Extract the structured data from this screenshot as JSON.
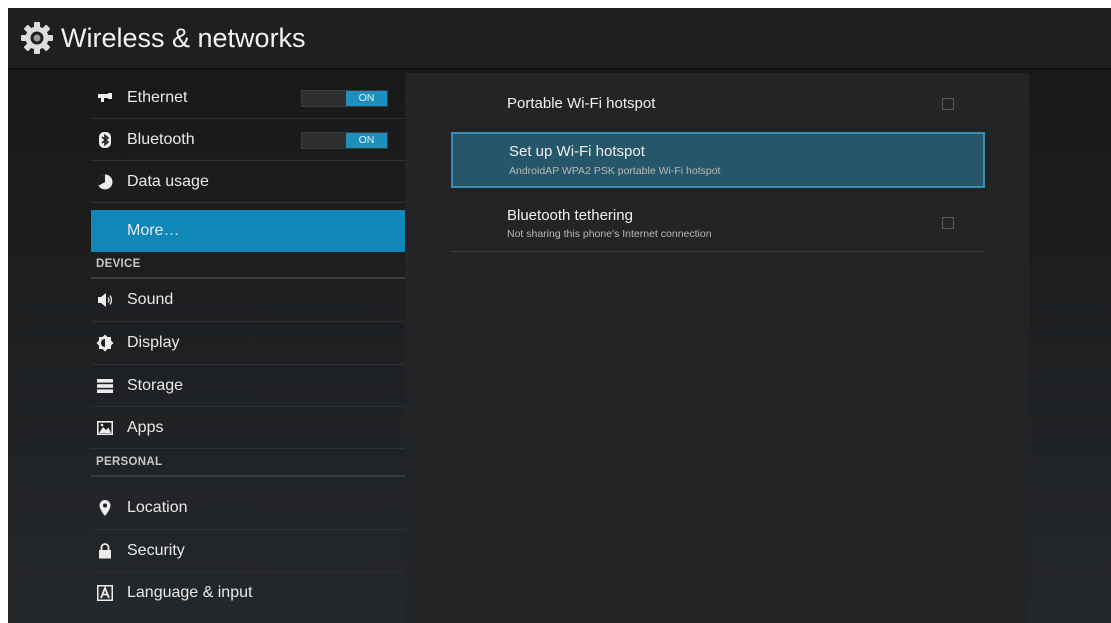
{
  "header": {
    "title": "Wireless & networks",
    "icon": "gear-icon"
  },
  "colors": {
    "accent": "#0f88b8",
    "toggle_on": "#1e8fbd",
    "focus_fill": "#26566a",
    "focus_border": "#3d8db1"
  },
  "sidebar": {
    "items": [
      {
        "label": "Ethernet",
        "icon": "ethernet-icon",
        "toggle": "ON"
      },
      {
        "label": "Bluetooth",
        "icon": "bluetooth-icon",
        "toggle": "ON"
      },
      {
        "label": "Data usage",
        "icon": "data-usage-icon"
      },
      {
        "label": "More…",
        "selected": true
      },
      {
        "label": "Sound",
        "icon": "sound-icon"
      },
      {
        "label": "Display",
        "icon": "display-icon"
      },
      {
        "label": "Storage",
        "icon": "storage-icon"
      },
      {
        "label": "Apps",
        "icon": "apps-icon"
      },
      {
        "label": "Location",
        "icon": "location-icon"
      },
      {
        "label": "Security",
        "icon": "lock-icon"
      },
      {
        "label": "Language & input",
        "icon": "language-icon"
      }
    ],
    "sections": {
      "device": "DEVICE",
      "personal": "PERSONAL"
    }
  },
  "detail": {
    "items": [
      {
        "title": "Portable Wi-Fi hotspot",
        "checked": false
      },
      {
        "title": "Set up Wi-Fi hotspot",
        "summary": "AndroidAP WPA2 PSK portable Wi-Fi hotspot",
        "focused": true
      },
      {
        "title": "Bluetooth tethering",
        "summary": "Not sharing this phone's Internet connection",
        "checked": false
      }
    ]
  }
}
